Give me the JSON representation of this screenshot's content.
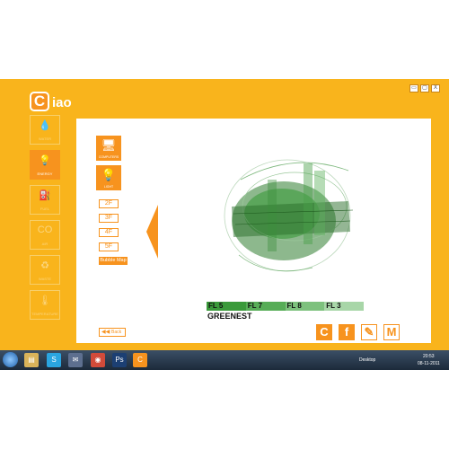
{
  "app": {
    "logo_letter": "C",
    "title": "iao",
    "window_buttons": [
      "▭",
      "▢",
      "X"
    ]
  },
  "sidebar": {
    "items": [
      {
        "icon": "water-drop-icon",
        "glyph": "💧",
        "label": "WATER",
        "active": false
      },
      {
        "icon": "bulb-icon",
        "glyph": "💡",
        "label": "ENERGY",
        "active": true
      },
      {
        "icon": "fuel-pump-icon",
        "glyph": "⛽",
        "label": "FUEL",
        "active": false
      },
      {
        "icon": "co2-icon",
        "glyph": "CO",
        "label": "AIR",
        "active": false
      },
      {
        "icon": "recycle-icon",
        "glyph": "♻",
        "label": "WASTE",
        "active": false
      },
      {
        "icon": "thermometer-icon",
        "glyph": "🌡",
        "label": "TEMPERATURE",
        "active": false
      }
    ]
  },
  "categories": {
    "computers": {
      "icon": "monitor-icon",
      "glyph": "🖥",
      "label": "COMPUTERS"
    },
    "light": {
      "icon": "bulb-icon",
      "glyph": "💡",
      "label": "LIGHT"
    }
  },
  "floors": [
    "2F",
    "3F",
    "4F",
    "5F"
  ],
  "bubble_map_label": "Bubble Map",
  "legend": {
    "items": [
      {
        "label": "FL 5",
        "color": "#3a9a3a"
      },
      {
        "label": "FL 7",
        "color": "#57ad57"
      },
      {
        "label": "FL 8",
        "color": "#7dc17d"
      },
      {
        "label": "FL 3",
        "color": "#a8d6a8"
      }
    ],
    "caption": "GREENEST"
  },
  "back_label": "Back",
  "share": [
    {
      "name": "ciao-share-icon",
      "glyph": "C",
      "filled": true
    },
    {
      "name": "facebook-icon",
      "glyph": "f",
      "filled": true
    },
    {
      "name": "blogger-icon",
      "glyph": "✎",
      "filled": false
    },
    {
      "name": "gmail-icon",
      "glyph": "M",
      "filled": false
    }
  ],
  "taskbar": {
    "apps": [
      {
        "name": "folder-icon",
        "glyph": "▤",
        "color": "#d9b35a"
      },
      {
        "name": "skype-icon",
        "glyph": "S",
        "color": "#2aa5e0"
      },
      {
        "name": "thunderbird-icon",
        "glyph": "✉",
        "color": "#5d6f8f"
      },
      {
        "name": "chrome-icon",
        "glyph": "◉",
        "color": "#d24b3a"
      },
      {
        "name": "photoshop-icon",
        "glyph": "Ps",
        "color": "#1c3f73"
      },
      {
        "name": "ciao-app-icon",
        "glyph": "C",
        "color": "#f7931e"
      }
    ],
    "desktop_label": "Desktop",
    "time": "20:53",
    "date": "08-11-2011"
  }
}
